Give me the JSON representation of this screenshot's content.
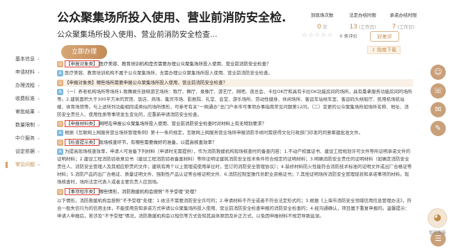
{
  "header": {
    "title": "公众聚集场所投入使用、营业前消防安全检...",
    "subtitle": "公众聚集场所投入使用、营业前消防安全检查...",
    "stats": [
      {
        "label": "到现场次数",
        "value": "0",
        "unit": "次"
      },
      {
        "label": "法定办结时限",
        "value": "13",
        "unit": "(工作日)"
      },
      {
        "label": "承诺办结时限",
        "value": "7",
        "unit": "(工作日)"
      }
    ],
    "rating_count_text": "0 条评价",
    "rate_button": "好差评",
    "guide_button": "指南下载",
    "apply_button": "立即办理"
  },
  "sidebar": {
    "items": [
      {
        "label": "基本信息"
      },
      {
        "label": "申请材料"
      },
      {
        "label": "办理流程"
      },
      {
        "label": "收费标准"
      },
      {
        "label": "审批结果"
      },
      {
        "label": "数量限制"
      },
      {
        "label": "中介服务"
      },
      {
        "label": "设定依据"
      },
      {
        "label": "常见问题",
        "active": true
      }
    ]
  },
  "faq": [
    {
      "tag": "【申报对象类】",
      "question": "医疗美容、教育培训机构是否需要办理公众聚集场所投入使用、营业前消防安全检查？",
      "answer": "医疗美容、教育培训机构不属于公众聚集场所，无需办理公众聚集场所投入使用、营业前消防安全检查。"
    },
    {
      "tag": "",
      "question": "【申报对象类】哪些场所需要申报公众聚集场所投入使用、营业前消防安全检查？",
      "answer": "（一）养老机构场所等场所1.歌舞娱乐放映游艺场所：歌厅、舞厅、录像厅、游艺厅、网吧、夜总会、卡拉OK厅和具有卡拉OK功能房间的场所，具有桑拿服务功能房间的场所等。2.建筑面积大于300平方米的宾馆、饭店、商场、集贸市场、影剧院、礼堂、会堂、游乐场所、劳动性健身、休闲场所、客运车站候车室、客运码头候船厅、民用机场航站楼、体育场馆等。与上述所列功能相同或类似的场所情形，可参考有关“一网通办”总门户本市可事项办事指南常见问题第12问。（二）变更的公众聚集场所如场所名称、地址、消防安全责任人、使用性质等事项发生变化的，应重新申请消防安全检查。"
    },
    {
      "tag": "【申报材料类】",
      "question": "网吧在申报公众聚集场所投入使用、营业前消防安全检查时对材料上有无特别要求？",
      "answer": "根据《互联网上网服务营业场所管理条例》第十一条的规定，互联网上网服务营业场所申报消防手续时需获得文化行政部门印发的同意筹建批准文件。"
    },
    {
      "tag": "【检查提示类】",
      "question": "现场核查环节，有哪些需要做好的准备，以提高核查效率？",
      "answer": "为提高现场核查效率，申请人可准备下列材料（申请时无需提供），作为消防救援机构现场核查时的备查内容：1.不动产权属证书、建设工程规划许可文件等所证明承诺文件的证明材料；2.建设工程消防验收意见书（建设工程消防验收备案材料）等所证明证建筑消防安全技术条件符合规定的证明材料；3.明确消防安全责任的证明材料（如确定消防安全责任人、消防安全管理人及其相应职责的文件；建筑有两个以上管理或使用单位时，签订的消防安全管理协议）；4.装修材料防火性能符合消防技术标准的证明文件或出厂合格证等材料；5.消防产品的出厂合格证、质量证明文件、强制性产品认证等合格证明文件、6.消防控制室操作员职业资格证书；7.其他证明场所消防安全管理现状和承诺事项的材料。现场核查时，场所法定代表人或者主要负责人应到场。"
    },
    {
      "tag": "【事项程序类】",
      "question": "哪些情形，消防救援机构会按照“不予受理”处理？",
      "answer": "以下情形，消防救援机构会按照“不予受理”处理：1.依法不需要消防安全许可的；2.申请材料不齐全或者不符合法定形式的；3.根据《上海市消防安全领域信用信息管理办法》，符合一般失信行为的信用主体，不能使用告知承诺方式申请公众聚集场所投入使用、营业前消防安全检查申报的消防安全检查的；4.经沟通确认，项目属于重复申报的。温馨提示：申请人申报后，若涉及“不予受理”情况，消防救援机构会以短信等方式告知其具体原因及补正方式，以免因申报材料不规范导致延误。"
    }
  ],
  "float_buttons": [
    {
      "icon": "user-icon"
    },
    {
      "icon": "phone-icon"
    },
    {
      "icon": "chat-icon"
    },
    {
      "icon": "message-icon"
    },
    {
      "icon": "feedback-icon"
    }
  ],
  "assistant_label": "智能客服"
}
